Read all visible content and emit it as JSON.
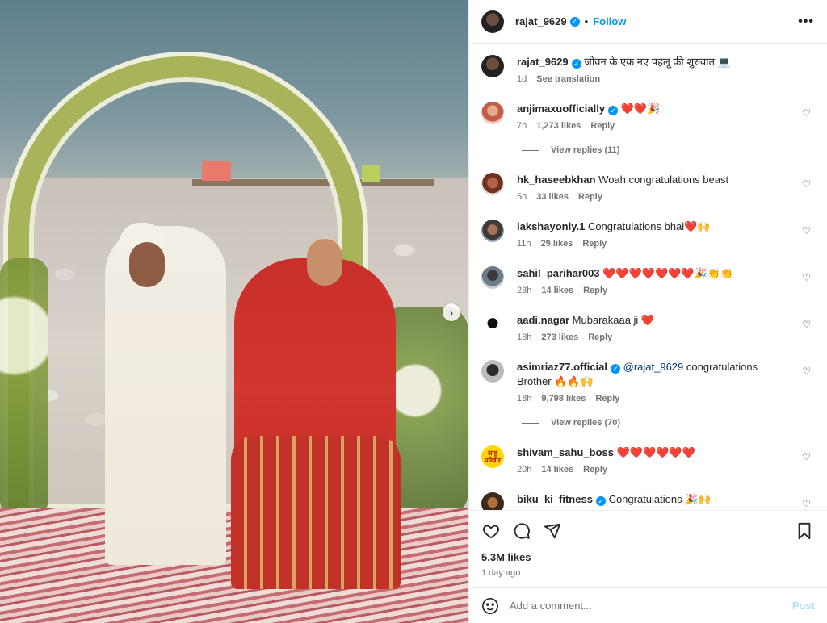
{
  "header": {
    "username": "rajat_9629",
    "dot": "•",
    "follow_label": "Follow",
    "more_label": "•••"
  },
  "photo": {
    "next_label": "›"
  },
  "caption": {
    "username": "rajat_9629",
    "text": "जीवन के एक नए पहलू की शुरुवात 💻",
    "time": "1d",
    "see_translation": "See translation"
  },
  "comments": [
    {
      "username": "anjimaxuofficially",
      "verified": true,
      "text": "❤️❤️🎉",
      "time": "7h",
      "likes": "1,273 likes",
      "reply": "Reply",
      "view_replies": "View replies (11)"
    },
    {
      "username": "hk_haseebkhan",
      "verified": false,
      "text": "Woah congratulations beast",
      "time": "5h",
      "likes": "33 likes",
      "reply": "Reply"
    },
    {
      "username": "lakshayonly.1",
      "verified": false,
      "text": "Congratulations bhai❤️🙌",
      "time": "11h",
      "likes": "29 likes",
      "reply": "Reply"
    },
    {
      "username": "sahil_parihar003",
      "verified": false,
      "text": "❤️❤️❤️❤️❤️❤️❤️🎉👏👏",
      "time": "23h",
      "likes": "14 likes",
      "reply": "Reply"
    },
    {
      "username": "aadi.nagar",
      "verified": false,
      "text": "Mubarakaaa ji ❤️",
      "time": "18h",
      "likes": "273 likes",
      "reply": "Reply"
    },
    {
      "username": "asimriaz77.official",
      "verified": true,
      "mention": "@rajat_9629",
      "text": "congratulations Brother 🔥🔥🙌",
      "time": "18h",
      "likes": "9,798 likes",
      "reply": "Reply",
      "view_replies": "View replies (70)"
    },
    {
      "username": "shivam_sahu_boss",
      "verified": false,
      "text": "❤️❤️❤️❤️❤️❤️",
      "time": "20h",
      "likes": "14 likes",
      "reply": "Reply",
      "avatar_text": "साहू परिवार"
    },
    {
      "username": "biku_ki_fitness",
      "verified": true,
      "text": "Congratulations 🎉🙌",
      "time": "",
      "likes": "",
      "reply": ""
    }
  ],
  "actions": {
    "likes": "5.3M likes",
    "ago": "1 day ago"
  },
  "add_comment": {
    "placeholder": "Add a comment...",
    "post_label": "Post"
  },
  "icons": [
    "heart-icon",
    "comment-icon",
    "share-icon",
    "bookmark-icon",
    "emoji-icon",
    "verified-icon",
    "chevron-right-icon",
    "more-icon"
  ],
  "colors": {
    "accent": "#0095f6",
    "post_disabled": "#b2dffc",
    "muted": "#737373"
  }
}
